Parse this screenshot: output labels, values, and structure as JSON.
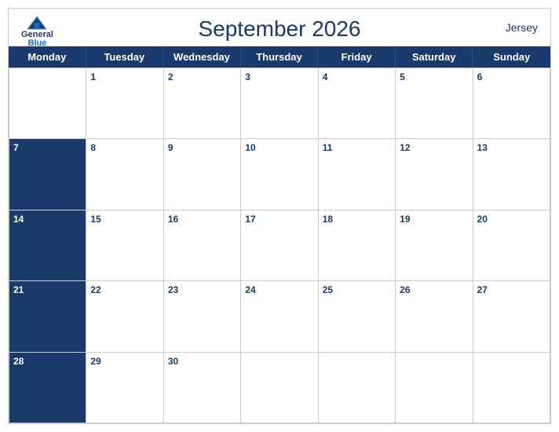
{
  "header": {
    "title": "September 2026",
    "region": "Jersey",
    "logo": {
      "line1": "General",
      "line2": "Blue"
    }
  },
  "days": [
    "Monday",
    "Tuesday",
    "Wednesday",
    "Thursday",
    "Friday",
    "Saturday",
    "Sunday"
  ],
  "weeks": [
    {
      "rowHeader": true,
      "cells": [
        "",
        "1",
        "2",
        "3",
        "4",
        "5",
        "6"
      ]
    },
    {
      "rowHeader": true,
      "cells": [
        "7",
        "8",
        "9",
        "10",
        "11",
        "12",
        "13"
      ]
    },
    {
      "rowHeader": true,
      "cells": [
        "14",
        "15",
        "16",
        "17",
        "18",
        "19",
        "20"
      ]
    },
    {
      "rowHeader": true,
      "cells": [
        "21",
        "22",
        "23",
        "24",
        "25",
        "26",
        "27"
      ]
    },
    {
      "rowHeader": true,
      "cells": [
        "28",
        "29",
        "30",
        "",
        "",
        "",
        ""
      ]
    }
  ],
  "colors": {
    "headerBg": "#1a3a6b",
    "headerText": "#ffffff",
    "titleColor": "#1a3a6b",
    "cellNumberColor": "#1a3a6b",
    "rowNumberColor": "#ffffff"
  }
}
